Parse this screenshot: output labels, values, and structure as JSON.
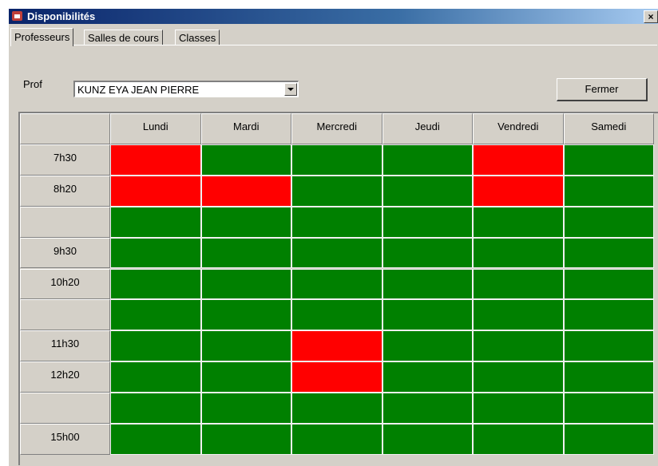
{
  "window": {
    "title": "Disponibilités",
    "close_glyph": "×"
  },
  "tabs": [
    {
      "label": "Professeurs",
      "active": true
    },
    {
      "label": "Salles de cours",
      "active": false
    },
    {
      "label": "Classes",
      "active": false
    }
  ],
  "filter": {
    "label": "Prof",
    "selected_value": "KUNZ EYA JEAN PIERRE"
  },
  "close_button": {
    "label": "Fermer"
  },
  "colors": {
    "available": "#008000",
    "unavailable": "#ff0000"
  },
  "schedule": {
    "days": [
      "Lundi",
      "Mardi",
      "Mercredi",
      "Jeudi",
      "Vendredi",
      "Samedi"
    ],
    "rows": [
      {
        "time": "7h30",
        "slots": [
          "unavailable",
          "available",
          "available",
          "available",
          "unavailable",
          "available"
        ]
      },
      {
        "time": "8h20",
        "slots": [
          "unavailable",
          "unavailable",
          "available",
          "available",
          "unavailable",
          "available"
        ]
      },
      {
        "time": "",
        "slots": [
          "available",
          "available",
          "available",
          "available",
          "available",
          "available"
        ]
      },
      {
        "time": "9h30",
        "slots": [
          "available",
          "available",
          "available",
          "available",
          "available",
          "available"
        ]
      },
      {
        "time": "10h20",
        "slots": [
          "available",
          "available",
          "available",
          "available",
          "available",
          "available"
        ]
      },
      {
        "time": "",
        "slots": [
          "available",
          "available",
          "available",
          "available",
          "available",
          "available"
        ]
      },
      {
        "time": "11h30",
        "slots": [
          "available",
          "available",
          "unavailable",
          "available",
          "available",
          "available"
        ]
      },
      {
        "time": "12h20",
        "slots": [
          "available",
          "available",
          "unavailable",
          "available",
          "available",
          "available"
        ]
      },
      {
        "time": "",
        "slots": [
          "available",
          "available",
          "available",
          "available",
          "available",
          "available"
        ]
      },
      {
        "time": "15h00",
        "slots": [
          "available",
          "available",
          "available",
          "available",
          "available",
          "available"
        ]
      }
    ]
  }
}
